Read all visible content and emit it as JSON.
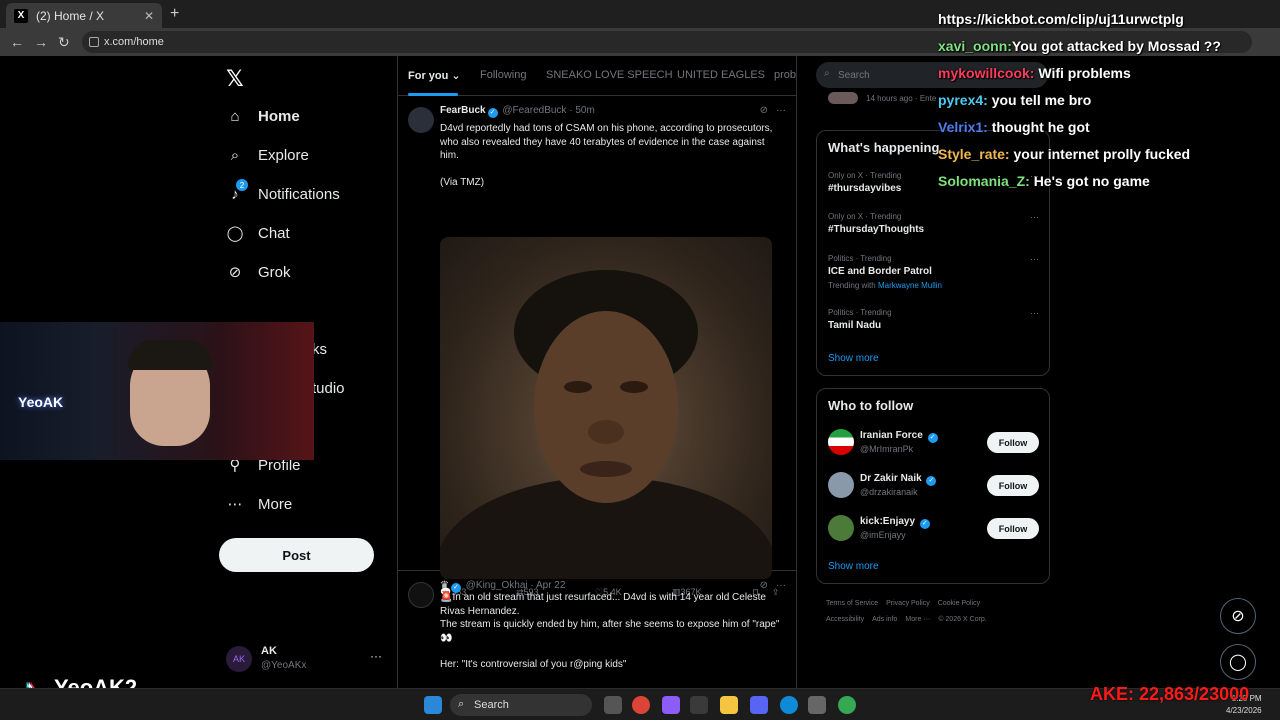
{
  "browser": {
    "tab_title": "(2) Home / X",
    "url": "x.com/home"
  },
  "sidebar": {
    "items": [
      {
        "label": "Home",
        "icon": "home-icon"
      },
      {
        "label": "Explore",
        "icon": "search-icon"
      },
      {
        "label": "Notifications",
        "icon": "bell-icon",
        "badge": "2"
      },
      {
        "label": "Chat",
        "icon": "chat-icon"
      },
      {
        "label": "Grok",
        "icon": "grok-icon"
      },
      {
        "label": "ks",
        "icon": "bookmark-icon"
      },
      {
        "label": "tudio",
        "icon": "studio-icon"
      },
      {
        "label": "Profile",
        "icon": "profile-icon"
      },
      {
        "label": "More",
        "icon": "more-icon"
      }
    ],
    "post_label": "Post",
    "account": {
      "name": "AK",
      "handle": "@YeoAKx"
    }
  },
  "timeline": {
    "tabs": [
      "For you",
      "Following",
      "SNEAKO LOVE SPEECH",
      "UNITED EAGLES",
      "prob"
    ],
    "tweet1": {
      "name": "FearBuck",
      "handle": "@FearedBuck",
      "time": "50m",
      "text": "D4vd reportedly had tons of CSAM on his phone, according to prosecutors, who also revealed they have 40 terabytes of evidence in the case against him.",
      "source": "(Via TMZ)",
      "replies": "353",
      "reposts": "593",
      "likes": "5.4K",
      "views": "367K"
    },
    "tweet2": {
      "handle": "@King_Okhai",
      "time": "Apr 22",
      "line1": "🚨In an old stream that just resurfaced... D4vd is with 14 year old Celeste Rivas Hernandez.",
      "line2": "The stream is quickly ended by him, after she seems to expose him of \"rape\" 👀",
      "line3": "Her: \"It's controversial of you r@ping kids\""
    }
  },
  "right": {
    "search_placeholder": "Search",
    "recent_time": "14 hours ago · Ente",
    "happening_title": "What's happening",
    "trends": [
      {
        "category": "Only on X · Trending",
        "name": "#thursdayvibes"
      },
      {
        "category": "Only on X · Trending",
        "name": "#ThursdayThoughts"
      },
      {
        "category": "Politics · Trending",
        "name": "ICE and Border Patrol",
        "with_prefix": "Trending with",
        "with": "Markwayne Mullin"
      },
      {
        "category": "Politics · Trending",
        "name": "Tamil Nadu"
      }
    ],
    "show_more": "Show more",
    "wtf_title": "Who to follow",
    "follow": [
      {
        "name": "Iranian Force",
        "handle": "@MrImranPk"
      },
      {
        "name": "Dr Zakir Naik",
        "handle": "@drzakiranaik"
      },
      {
        "name": "kick:Enjayy",
        "handle": "@imEnjayy"
      }
    ],
    "follow_label": "Follow",
    "footer": [
      "Terms of Service",
      "Privacy Policy",
      "Cookie Policy",
      "Accessibility",
      "Ads info",
      "More ···",
      "© 2026 X Corp."
    ]
  },
  "chat": [
    {
      "user": "",
      "text": "https://kickbot.com/clip/uj11urwctplg",
      "color": "#ffffff"
    },
    {
      "user": "xavi_oonn:",
      "text": "You got attacked by Mossad ??",
      "color": "#7ee07e"
    },
    {
      "user": "mykowillcook:",
      "text": "Wifi problems",
      "color": "#ff3b5c"
    },
    {
      "user": "pyrex4:",
      "text": "you tell me bro",
      "color": "#4fc9f0"
    },
    {
      "user": "Velrix1:",
      "text": "thought he got",
      "color": "#4f7cf0"
    },
    {
      "user": "Style_rate:",
      "text": "your internet prolly fucked",
      "color": "#f0b84f"
    },
    {
      "user": "Solomania_Z:",
      "text": "He's got no game",
      "color": "#7ee07e"
    }
  ],
  "overlay": {
    "cam_label": "YeoAK",
    "tiktok_name": "YeoAK2",
    "ake_counter": "AKE: 22,863/23000"
  },
  "taskbar": {
    "search": "Search",
    "time": "1:25 PM",
    "date": "4/23/2026"
  }
}
